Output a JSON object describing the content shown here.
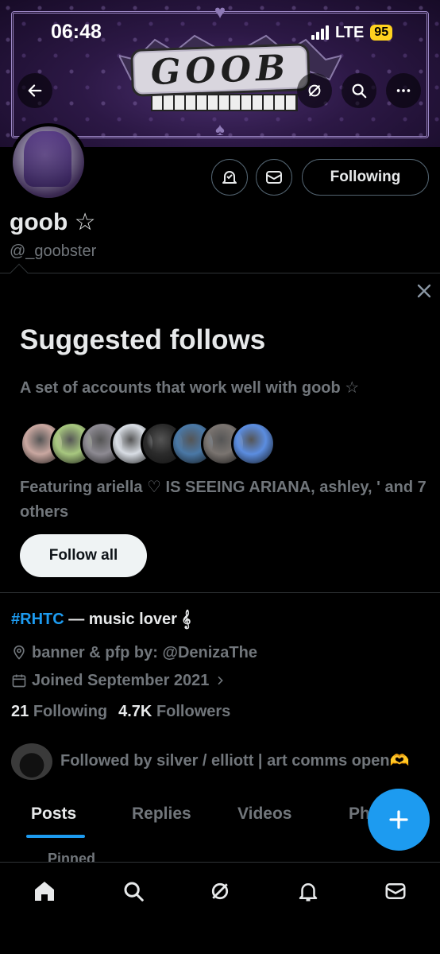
{
  "status_bar": {
    "time": "06:48",
    "network": "LTE",
    "battery": "95"
  },
  "banner": {
    "logo_text": "GOOB"
  },
  "profile": {
    "display_name": "goob ☆",
    "handle": "@_goobster",
    "following_button": "Following"
  },
  "suggested": {
    "title": "Suggested follows",
    "subtitle": "A set of accounts that work well with goob ☆",
    "featuring": "Featuring ariella ♡ IS SEEING ARIANA, ashley, ' and 7 others",
    "follow_all": "Follow all",
    "avatar_colors": [
      "#c9a7a0",
      "#a7c77f",
      "#8d8a92",
      "#d8dde4",
      "#2b2b2b",
      "#4a78a6",
      "#7a7470",
      "#5b8de0"
    ]
  },
  "bio": {
    "hashtag": "#RHTC",
    "text": " — music lover 𝄞",
    "location": "banner & pfp by: @DenizaThe",
    "joined": "Joined September 2021",
    "following_count": "21",
    "following_label": "Following",
    "followers_count": "4.7K",
    "followers_label": "Followers",
    "followed_by": "Followed by silver / elliott | art comms open🫶"
  },
  "tabs": [
    "Posts",
    "Replies",
    "Videos",
    "Ph"
  ],
  "pinned_label": "Pinned",
  "colors": {
    "accent": "#1d9bf0",
    "background": "#000000",
    "muted": "#71767b"
  }
}
